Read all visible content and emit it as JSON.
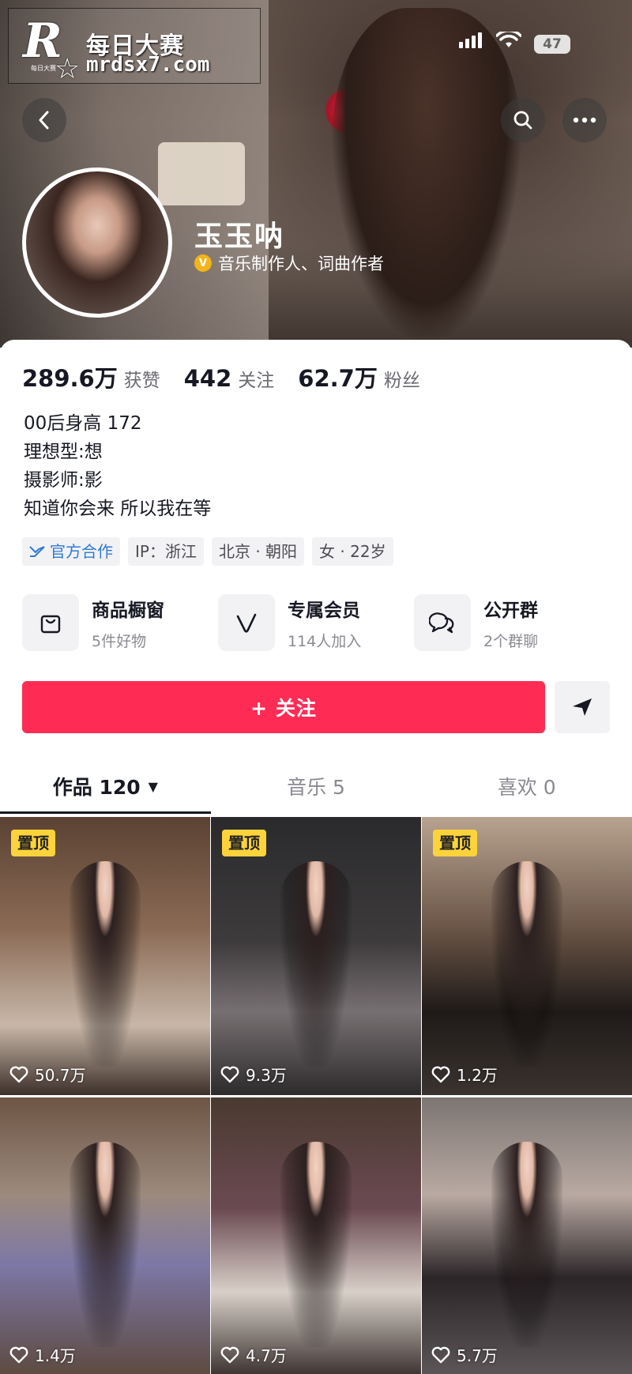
{
  "watermark": {
    "logo": "R",
    "line1": "每日大赛",
    "line2": "mrdsx7.com",
    "small": "每日大赛",
    "star": "☆"
  },
  "status_bar": {
    "battery": "47"
  },
  "profile": {
    "nickname": "玉玉呐",
    "verify_badge": "V",
    "verify_text": "音乐制作人、词曲作者"
  },
  "stats": [
    {
      "num": "289.6万",
      "label": "获赞"
    },
    {
      "num": "442",
      "label": "关注"
    },
    {
      "num": "62.7万",
      "label": "粉丝"
    }
  ],
  "bio": [
    "00后身高 172",
    "理想型:想",
    "摄影师:影",
    "知道你会来  所以我在等"
  ],
  "tags": {
    "official": "官方合作",
    "ip": "IP：浙江",
    "location": "北京 · 朝阳",
    "gender_age": "女 · 22岁"
  },
  "services": [
    {
      "title": "商品橱窗",
      "sub": "5件好物",
      "icon": "shopping-bag-icon"
    },
    {
      "title": "专属会员",
      "sub": "114人加入",
      "icon": "v-member-icon"
    },
    {
      "title": "公开群",
      "sub": "2个群聊",
      "icon": "chat-bubbles-icon"
    }
  ],
  "follow_button": "+ 关注",
  "tabs": [
    {
      "label": "作品 120",
      "active": true
    },
    {
      "label": "音乐 5",
      "active": false
    },
    {
      "label": "喜欢 0",
      "active": false
    }
  ],
  "videos": [
    {
      "likes": "50.7万",
      "pinned": true
    },
    {
      "likes": "9.3万",
      "pinned": true
    },
    {
      "likes": "1.2万",
      "pinned": true
    },
    {
      "likes": "1.4万",
      "pinned": false
    },
    {
      "likes": "4.7万",
      "pinned": false
    },
    {
      "likes": "5.7万",
      "pinned": false
    }
  ],
  "pin_label": "置顶",
  "colors": {
    "accent": "#fe2c55",
    "pin": "#fcd33b",
    "official_blue": "#2f7ad6",
    "verify_gold": "#f2b418"
  }
}
